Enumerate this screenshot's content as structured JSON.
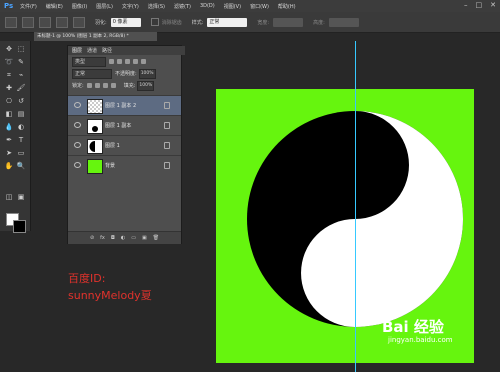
{
  "app": {
    "logo": "Ps"
  },
  "menu": [
    "文件(F)",
    "编辑(E)",
    "图像(I)",
    "图层(L)",
    "文字(Y)",
    "选择(S)",
    "滤镜(T)",
    "3D(D)",
    "视图(V)",
    "窗口(W)",
    "帮助(H)"
  ],
  "window_controls": {
    "minimize": "–",
    "maximize": "□",
    "close": "✕"
  },
  "options_bar": {
    "feather_label": "羽化:",
    "feather_value": "0 像素",
    "antialias_label": "消除锯齿",
    "style_label": "样式:",
    "style_value": "正常",
    "width_label": "宽度:",
    "height_label": "高度:"
  },
  "document_tab": "未标题-1 @ 100% (图层 1 副本 2, RGB/8) *",
  "layers_panel": {
    "tabs": [
      "图层",
      "通道",
      "路径"
    ],
    "filter_label": "类型",
    "blend_mode": "正常",
    "opacity_label": "不透明度:",
    "opacity_value": "100%",
    "lock_label": "锁定:",
    "fill_label": "填充:",
    "fill_value": "100%",
    "layers": [
      {
        "name": "图层 1 副本 2",
        "thumb": "checker",
        "active": true
      },
      {
        "name": "图层 1 副本",
        "thumb": "half-dot",
        "active": false
      },
      {
        "name": "图层 1",
        "thumb": "half-moon",
        "active": false
      },
      {
        "name": "背景",
        "thumb": "green",
        "active": false
      }
    ],
    "footer_icons": [
      "link-icon",
      "fx-icon",
      "mask-icon",
      "adjust-icon",
      "folder-icon",
      "new-layer-icon",
      "trash-icon"
    ],
    "footer_glyphs": [
      "⊘",
      "fx",
      "◘",
      "◐",
      "▭",
      "▣",
      "🗑"
    ]
  },
  "colors": {
    "foreground": "#ffffff",
    "background": "#000000",
    "canvas_bg": "#66f50e",
    "guide": "#36c9ff"
  },
  "watermark": {
    "line1": "百度ID:",
    "line2": "sunnyMelody夏",
    "brand": "Bai 经验",
    "url": "jingyan.baidu.com"
  }
}
